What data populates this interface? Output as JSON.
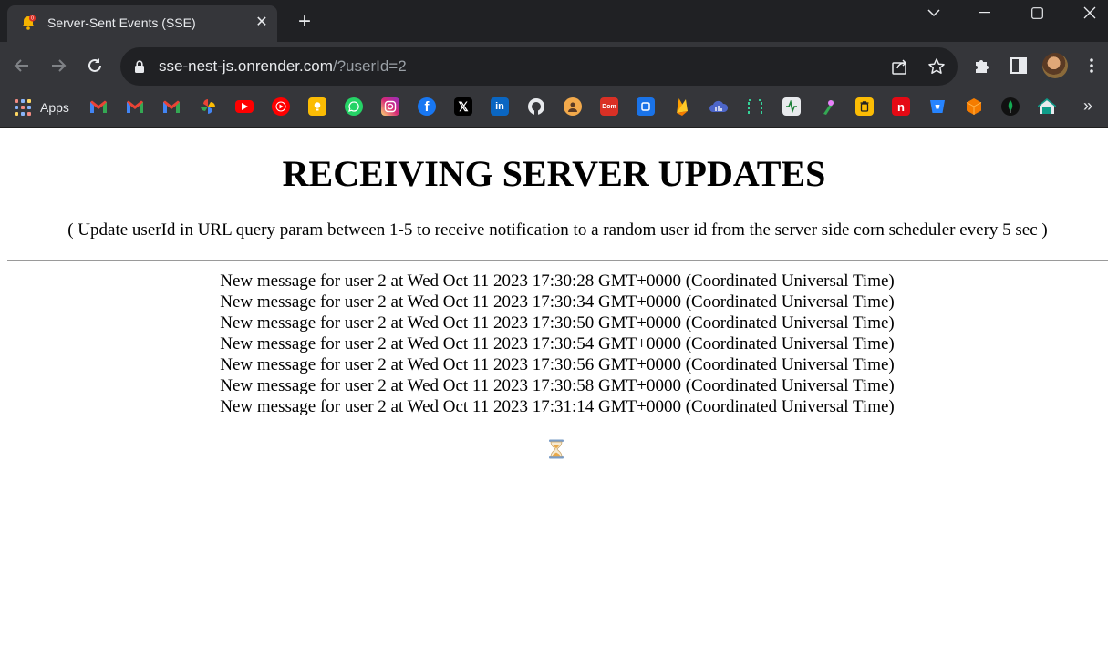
{
  "browser": {
    "tab": {
      "title": "Server-Sent Events (SSE)",
      "favicon": "bell-icon"
    },
    "address": {
      "host": "sse-nest-js.onrender.com",
      "path": "/?userId=2"
    },
    "bookmarks": {
      "apps_label": "Apps",
      "icons": [
        "gmail-icon",
        "gmail-icon",
        "gmail-icon",
        "google-photos-icon",
        "youtube-icon",
        "youtube-music-icon",
        "google-keep-icon",
        "whatsapp-icon",
        "instagram-icon",
        "facebook-icon",
        "x-icon",
        "linkedin-icon",
        "github-icon",
        "profile-icon",
        "dom-icon",
        "square-app-icon",
        "firebase-icon",
        "cloud-icon",
        "bracket-icon",
        "activity-icon",
        "pen-icon",
        "trash-can-icon",
        "netflix-n-icon",
        "bitbucket-icon",
        "cube-icon",
        "mongodb-leaf-icon",
        "house-icon"
      ]
    }
  },
  "page": {
    "heading": "RECEIVING SERVER UPDATES",
    "subtitle": "( Update userId in URL query param between 1-5 to receive notification to a random user id from the server side corn scheduler every 5 sec )",
    "messages": [
      "New message for user 2 at Wed Oct 11 2023 17:30:28 GMT+0000 (Coordinated Universal Time)",
      "New message for user 2 at Wed Oct 11 2023 17:30:34 GMT+0000 (Coordinated Universal Time)",
      "New message for user 2 at Wed Oct 11 2023 17:30:50 GMT+0000 (Coordinated Universal Time)",
      "New message for user 2 at Wed Oct 11 2023 17:30:54 GMT+0000 (Coordinated Universal Time)",
      "New message for user 2 at Wed Oct 11 2023 17:30:56 GMT+0000 (Coordinated Universal Time)",
      "New message for user 2 at Wed Oct 11 2023 17:30:58 GMT+0000 (Coordinated Universal Time)",
      "New message for user 2 at Wed Oct 11 2023 17:31:14 GMT+0000 (Coordinated Universal Time)"
    ],
    "loading_icon": "hourglass-icon"
  },
  "colors": {
    "chrome_dark": "#202124",
    "chrome_toolbar": "#35363a",
    "chrome_text": "#e8eaed",
    "page_background": "#ffffff"
  }
}
